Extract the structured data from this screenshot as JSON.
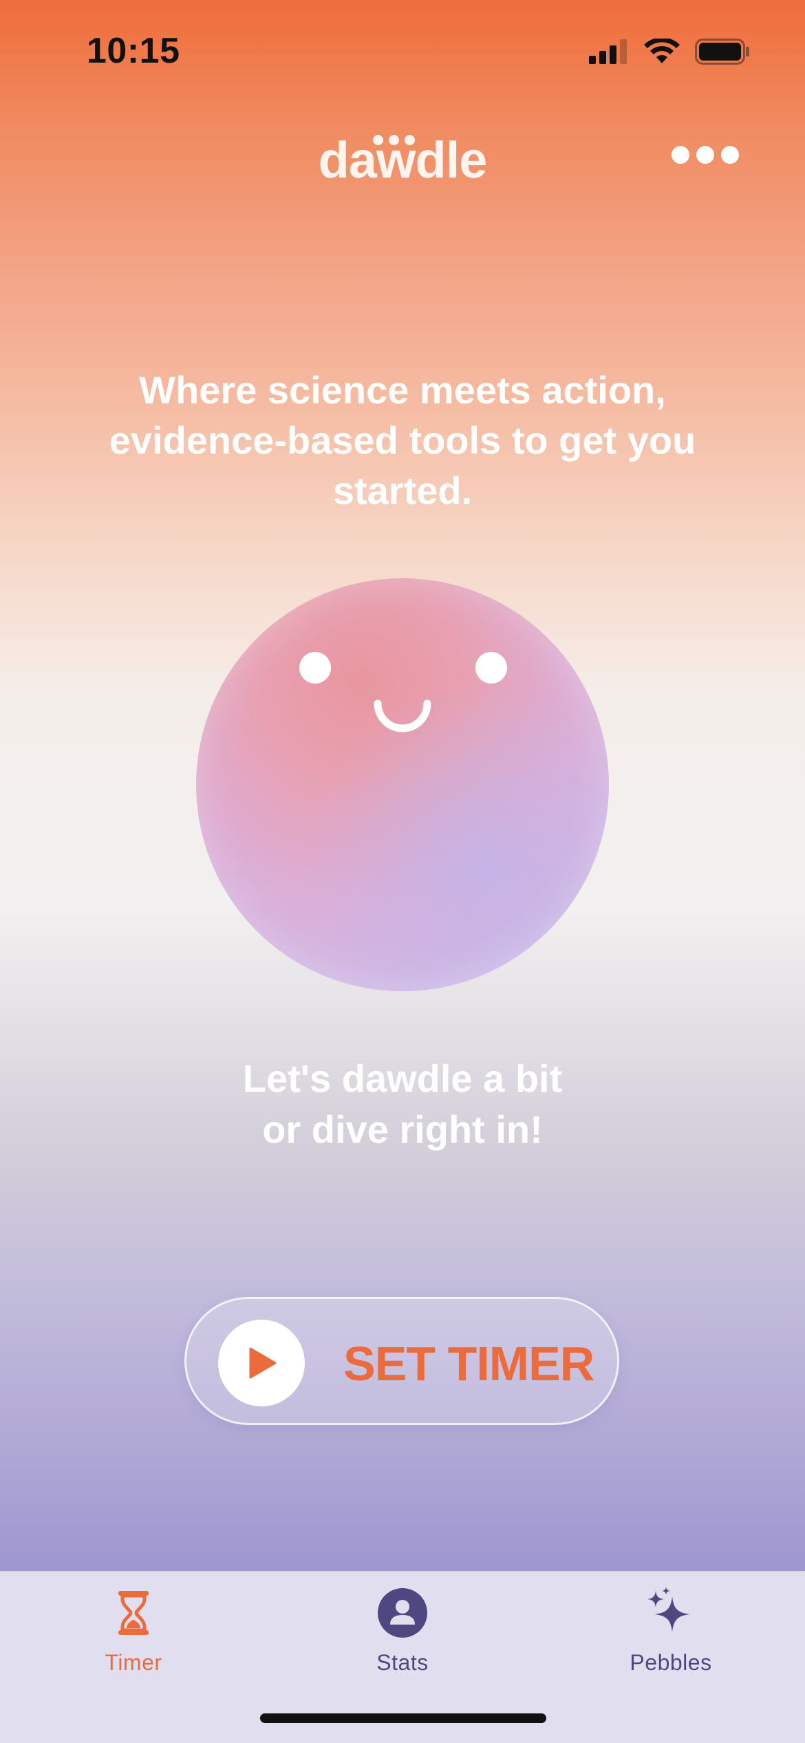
{
  "status_bar": {
    "time": "10:15"
  },
  "header": {
    "logo_text": "dawdle"
  },
  "main": {
    "tagline": "Where science meets action, evidence-based tools to get you started.",
    "subtitle_line1": "Let's dawdle a bit",
    "subtitle_line2": "or dive right in!",
    "set_timer_label": "SET TIMER"
  },
  "tabs": [
    {
      "label": "Timer",
      "icon": "hourglass-icon",
      "active": true
    },
    {
      "label": "Stats",
      "icon": "user-circle-icon",
      "active": false
    },
    {
      "label": "Pebbles",
      "icon": "sparkles-icon",
      "active": false
    }
  ],
  "colors": {
    "accent": "#ec6b3c",
    "tab_inactive": "#4f4880",
    "tab_bar_bg": "#e1dfef"
  }
}
